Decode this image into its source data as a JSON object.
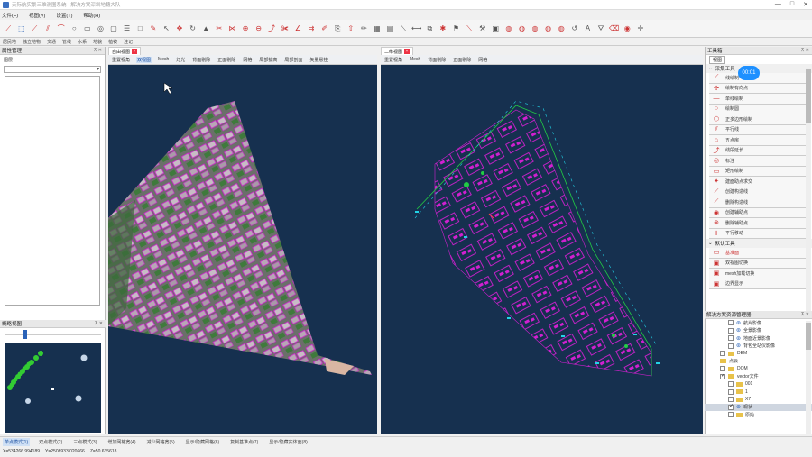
{
  "app": {
    "title": "天际航实景三维测图系统 - 解决方案深圳地籍大队"
  },
  "window_controls": {
    "minimize": "—",
    "maximize": "□",
    "close": "✕"
  },
  "menu": [
    "文件(F)",
    "视图(V)",
    "设置(T)",
    "帮助(H)"
  ],
  "category_tabs": [
    "居民地",
    "独立地物",
    "交通",
    "管线",
    "水系",
    "地貌",
    "植被",
    "注记"
  ],
  "left_panel": {
    "title": "属性管理",
    "field_label": "图层"
  },
  "thumbnail_panel": {
    "title": "概略视图"
  },
  "view3d": {
    "tab_label": "自由视图",
    "toolbar": [
      "重置视角",
      "双视图",
      "Mesh",
      "灯光",
      "背面剔除",
      "正面剔除",
      "网格",
      "局部拔高",
      "局部剖面",
      "矢量悬挂"
    ],
    "active_tool": "双视图"
  },
  "view2d": {
    "tab_label": "二维视图",
    "toolbar": [
      "重置视角",
      "Mesh",
      "背面剔除",
      "正面剔除",
      "网格"
    ]
  },
  "toolbox": {
    "title": "工具箱",
    "tab": "视图",
    "group1": "采集工具",
    "items1": [
      "线绘制",
      "绘制有向点",
      "单线绘制",
      "绘制圆",
      "正多边形绘制",
      "平行线",
      "五点房",
      "线段延长",
      "标注",
      "矩形绘制",
      "建面助点求交",
      "创建构造线",
      "删除构造线",
      "创建辅助点",
      "删除辅助点",
      "平行移动"
    ],
    "group2": "默认工具",
    "items2": [
      "基准面",
      "双视图切换",
      "mesh加载切换",
      "边界显示"
    ],
    "badge": "00:01"
  },
  "resource_panel": {
    "title": "解决方案资源管理器",
    "tree": [
      {
        "label": "航片影像",
        "type": "layer",
        "indent": 2,
        "checked": false
      },
      {
        "label": "全景影像",
        "type": "layer",
        "indent": 2,
        "checked": false
      },
      {
        "label": "地面近景影像",
        "type": "layer",
        "indent": 2,
        "checked": false
      },
      {
        "label": "背包全站仪影像",
        "type": "layer",
        "indent": 2,
        "checked": false
      },
      {
        "label": "DEM",
        "type": "folder",
        "indent": 1,
        "checked": false
      },
      {
        "label": "点云",
        "type": "folder",
        "indent": 1,
        "checked": null
      },
      {
        "label": "DOM",
        "type": "folder",
        "indent": 1,
        "checked": false
      },
      {
        "label": "vector文件",
        "type": "folder",
        "indent": 1,
        "checked": true
      },
      {
        "label": "001",
        "type": "folder",
        "indent": 2,
        "checked": false
      },
      {
        "label": "1",
        "type": "folder",
        "indent": 2,
        "checked": false
      },
      {
        "label": "X7",
        "type": "folder",
        "indent": 2,
        "checked": false
      },
      {
        "label": "现状",
        "type": "layer",
        "indent": 2,
        "checked": true,
        "selected": true
      },
      {
        "label": "原始",
        "type": "folder",
        "indent": 2,
        "checked": false
      }
    ]
  },
  "status_modes": [
    "单点模式(1)",
    "双点模式(2)",
    "三点模式(3)",
    "增加网格宽(4)",
    "减少网格宽(5)",
    "显示/隐藏网格(6)",
    "复制基准点(7)",
    "显示/隐藏实体面(8)"
  ],
  "active_mode": "单点模式(1)",
  "coords": {
    "x": "X=534266.994189",
    "y": "Y=2508933.020666",
    "z": "Z=50.635618"
  },
  "colors": {
    "viewport_bg": "#16304f",
    "vector_magenta": "#d020d0",
    "vector_green": "#22cc44",
    "vector_cyan": "#22d3e6",
    "accent_blue": "#2a63b8"
  }
}
